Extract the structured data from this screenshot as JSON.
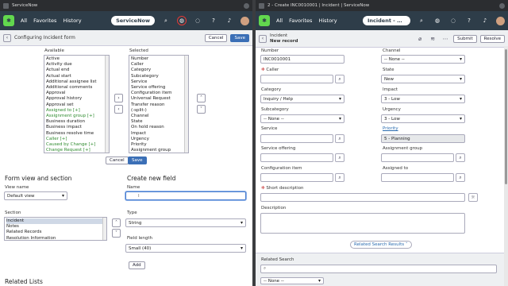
{
  "left": {
    "tab_title": "ServiceNow",
    "nav": {
      "all": "All",
      "favorites": "Favorites",
      "history": "History",
      "pill": "ServiceNow"
    },
    "header": {
      "title": "Configuring Incident form",
      "cancel": "Cancel",
      "save": "Save"
    },
    "available": {
      "label": "Available",
      "items": [
        {
          "text": "Active",
          "green": false
        },
        {
          "text": "Activity due",
          "green": false
        },
        {
          "text": "Actual end",
          "green": false
        },
        {
          "text": "Actual start",
          "green": false
        },
        {
          "text": "Additional assignee list",
          "green": false
        },
        {
          "text": "Additional comments",
          "green": false
        },
        {
          "text": "Approval",
          "green": false
        },
        {
          "text": "Approval history",
          "green": false
        },
        {
          "text": "Approval set",
          "green": false
        },
        {
          "text": "Assigned to [+]",
          "green": true
        },
        {
          "text": "Assignment group [+]",
          "green": true
        },
        {
          "text": "Business duration",
          "green": false
        },
        {
          "text": "Business impact",
          "green": false
        },
        {
          "text": "Business resolve time",
          "green": false
        },
        {
          "text": "Caller [+]",
          "green": true
        },
        {
          "text": "Caused by Change [+]",
          "green": true
        },
        {
          "text": "Change Request [+]",
          "green": true
        }
      ]
    },
    "selected": {
      "label": "Selected",
      "items": [
        "Number",
        "Caller",
        "Category",
        "Subcategory",
        "Service",
        "Service offering",
        "Configuration item",
        "Universal Request",
        "Transfer reason",
        "(-split-)",
        "Channel",
        "State",
        "On hold reason",
        "Impact",
        "Urgency",
        "Priority",
        "Assignment group"
      ]
    },
    "form_actions": {
      "cancel": "Cancel",
      "save": "Save"
    },
    "form_view": {
      "heading": "Form view and section",
      "view_label": "View name",
      "view_value": "Default view",
      "section_label": "Section",
      "sections": [
        "Incident",
        "Notes",
        "Related Records",
        "Resolution Information"
      ]
    },
    "new_field": {
      "heading": "Create new field",
      "name_label": "Name",
      "name_value": "",
      "type_label": "Type",
      "type_value": "String",
      "length_label": "Field length",
      "length_value": "Small (40)",
      "add": "Add"
    },
    "bottom_cut": "Related Lists"
  },
  "right": {
    "tab_title": "2 - Create INC0010001 | Incident | ServiceNow",
    "nav": {
      "all": "All",
      "favorites": "Favorites",
      "history": "History",
      "pill": "Incident - Cre..."
    },
    "header": {
      "line1": "Incident",
      "line2": "New record",
      "submit": "Submit",
      "resolve": "Resolve"
    },
    "fields": {
      "number_label": "Number",
      "number_value": "INC0010001",
      "caller_label": "Caller",
      "caller_value": "",
      "category_label": "Category",
      "category_value": "Inquiry / Help",
      "subcategory_label": "Subcategory",
      "subcategory_value": "-- None --",
      "service_label": "Service",
      "service_value": "",
      "service_offering_label": "Service offering",
      "service_offering_value": "",
      "ci_label": "Configuration item",
      "ci_value": "",
      "channel_label": "Channel",
      "channel_value": "-- None --",
      "state_label": "State",
      "state_value": "New",
      "impact_label": "Impact",
      "impact_value": "3 - Low",
      "urgency_label": "Urgency",
      "urgency_value": "3 - Low",
      "priority_label": "Priority",
      "priority_value": "5 - Planning",
      "assignment_group_label": "Assignment group",
      "assignment_group_value": "",
      "assigned_to_label": "Assigned to",
      "assigned_to_value": "",
      "short_desc_label": "Short description",
      "short_desc_value": "",
      "description_label": "Description",
      "description_value": ""
    },
    "related_results": "Related Search Results",
    "related_search_label": "Related Search",
    "related_search_value": "",
    "related_cut": "-- None --"
  }
}
